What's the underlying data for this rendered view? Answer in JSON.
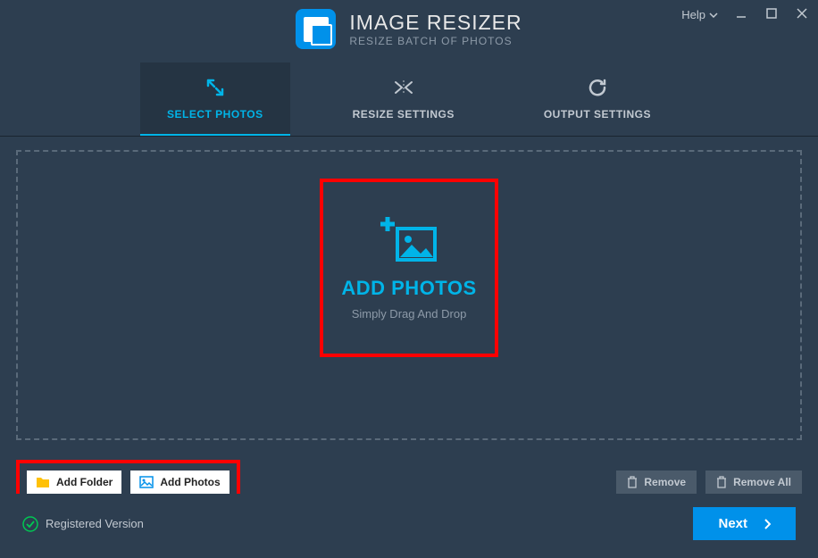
{
  "app": {
    "title": "IMAGE RESIZER",
    "subtitle": "RESIZE BATCH OF PHOTOS"
  },
  "window": {
    "help": "Help"
  },
  "tabs": {
    "select": "SELECT PHOTOS",
    "resize": "RESIZE SETTINGS",
    "output": "OUTPUT SETTINGS"
  },
  "dropzone": {
    "title": "ADD PHOTOS",
    "subtitle": "Simply Drag And Drop"
  },
  "toolbar": {
    "add_folder": "Add Folder",
    "add_photos": "Add Photos",
    "remove": "Remove",
    "remove_all": "Remove All"
  },
  "footer": {
    "status": "Registered Version",
    "next": "Next"
  }
}
